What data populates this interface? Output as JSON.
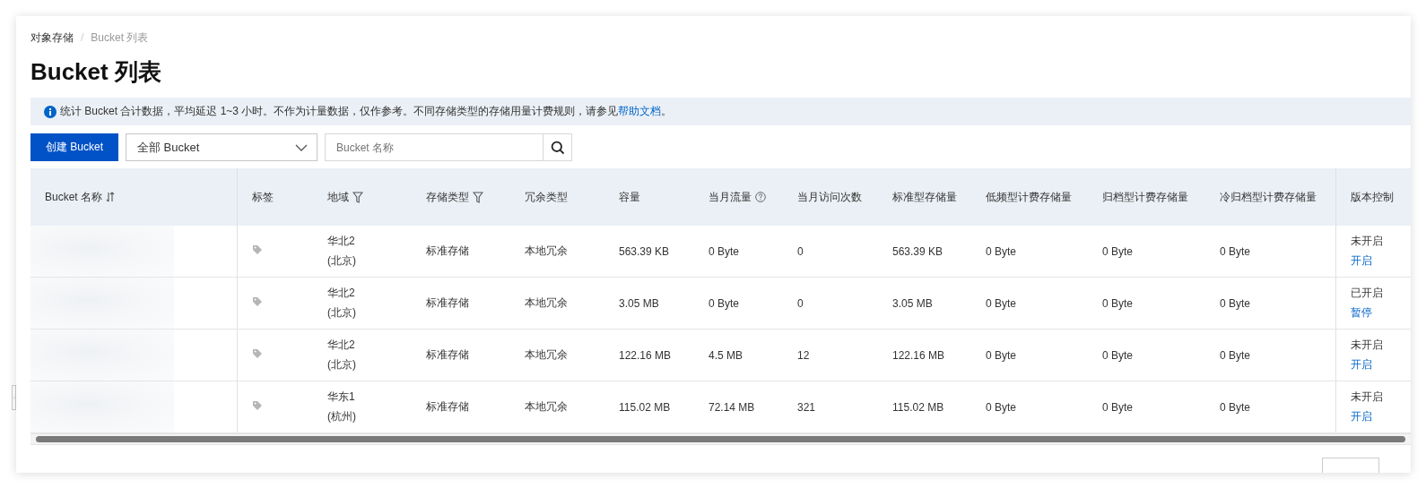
{
  "breadcrumb_separator": "/",
  "breadcrumb": [
    {
      "label": "对象存储",
      "current": false
    },
    {
      "label": "Bucket 列表",
      "current": true
    }
  ],
  "title": "Bucket 列表",
  "notice": {
    "text": "统计 Bucket 合计数据，平均延迟 1~3 小时。不作为计量数据，仅作参考。不同存储类型的存储用量计费规则，请参见",
    "link": "帮助文档",
    "end": "。"
  },
  "toolbar": {
    "create_button": "创建 Bucket",
    "filter_select": "全部 Bucket",
    "search": {
      "placeholder": "Bucket 名称"
    }
  },
  "table": {
    "columns": [
      {
        "label": "Bucket 名称",
        "kind": "sortable"
      },
      {
        "label": "标签"
      },
      {
        "label": "地域",
        "kind": "filterable"
      },
      {
        "label": "存储类型",
        "kind": "filterable"
      },
      {
        "label": "冗余类型"
      },
      {
        "label": "容量"
      },
      {
        "label": "当月流量",
        "kind": "help"
      },
      {
        "label": "当月访问次数"
      },
      {
        "label": "标准型存储量"
      },
      {
        "label": "低频型计费存储量"
      },
      {
        "label": "归档型计费存储量"
      },
      {
        "label": "冷归档型计费存储量"
      },
      {
        "label": "版本控制"
      }
    ],
    "rows": [
      {
        "region": "华北2",
        "city": "(北京)",
        "storage_class": "标准存储",
        "redundancy": "本地冗余",
        "capacity": "563.39 KB",
        "traffic": "0 Byte",
        "requests": "0",
        "standard": "563.39 KB",
        "ia": "0 Byte",
        "archive": "0 Byte",
        "cold_archive": "0 Byte",
        "versioning": "未开启",
        "versioning_action": "开启"
      },
      {
        "region": "华北2",
        "city": "(北京)",
        "storage_class": "标准存储",
        "redundancy": "本地冗余",
        "capacity": "3.05 MB",
        "traffic": "0 Byte",
        "requests": "0",
        "standard": "3.05 MB",
        "ia": "0 Byte",
        "archive": "0 Byte",
        "cold_archive": "0 Byte",
        "versioning": "已开启",
        "versioning_action": "暂停"
      },
      {
        "region": "华北2",
        "city": "(北京)",
        "storage_class": "标准存储",
        "redundancy": "本地冗余",
        "capacity": "122.16 MB",
        "traffic": "4.5 MB",
        "requests": "12",
        "standard": "122.16 MB",
        "ia": "0 Byte",
        "archive": "0 Byte",
        "cold_archive": "0 Byte",
        "versioning": "未开启",
        "versioning_action": "开启"
      },
      {
        "region": "华东1",
        "city": "(杭州)",
        "storage_class": "标准存储",
        "redundancy": "本地冗余",
        "capacity": "115.02 MB",
        "traffic": "72.14 MB",
        "requests": "321",
        "standard": "115.02 MB",
        "ia": "0 Byte",
        "archive": "0 Byte",
        "cold_archive": "0 Byte",
        "versioning": "未开启",
        "versioning_action": "开启"
      }
    ]
  }
}
